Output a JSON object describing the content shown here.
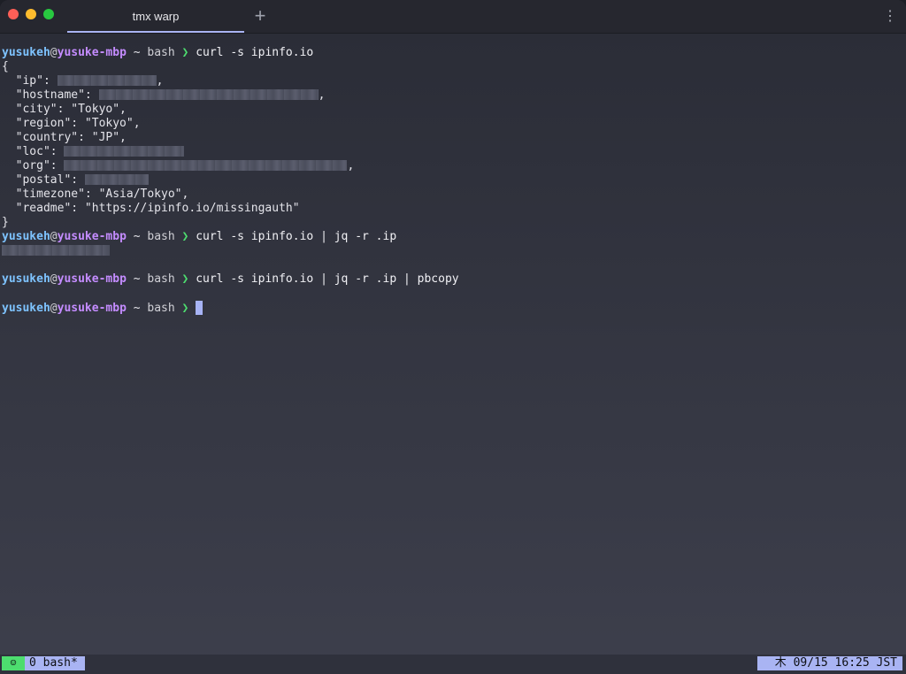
{
  "window": {
    "tab_title": "tmx warp",
    "new_tab_glyph": "+",
    "menu_glyph": "⋮"
  },
  "prompt": {
    "user": "yusukeh",
    "at": "@",
    "host": "yusuke-mbp",
    "path": "~",
    "shell": "bash",
    "arrow": "❯"
  },
  "commands": [
    "curl -s ipinfo.io",
    "curl -s ipinfo.io | jq -r .ip",
    "curl -s ipinfo.io | jq -r .ip | pbcopy"
  ],
  "json_output": {
    "open": "{",
    "ip_key": "  \"ip\": ",
    "ip_suffix": ",",
    "hostname_key": "  \"hostname\": ",
    "hostname_suffix": ",",
    "city": "  \"city\": \"Tokyo\",",
    "region": "  \"region\": \"Tokyo\",",
    "country": "  \"country\": \"JP\",",
    "loc_key": "  \"loc\": ",
    "org_key": "  \"org\": ",
    "org_suffix": ",",
    "postal_key": "  \"postal\": ",
    "timezone": "  \"timezone\": \"Asia/Tokyo\",",
    "readme": "  \"readme\": \"https://ipinfo.io/missingauth\"",
    "close": "}"
  },
  "status_bar": {
    "session_icon": "☺",
    "window_label": "0 bash*",
    "datetime": "木 09/15 16:25 JST"
  },
  "colors": {
    "user": "#7ec3ff",
    "host": "#c48cff",
    "arrow": "#4ddd6f",
    "accent": "#a9b4f3",
    "status_green": "#4ddd6f"
  },
  "icons": {
    "close": "close-icon",
    "minimize": "minimize-icon",
    "maximize": "maximize-icon",
    "new_tab": "plus-icon",
    "menu": "more-vertical-icon",
    "session": "smiley-icon"
  }
}
